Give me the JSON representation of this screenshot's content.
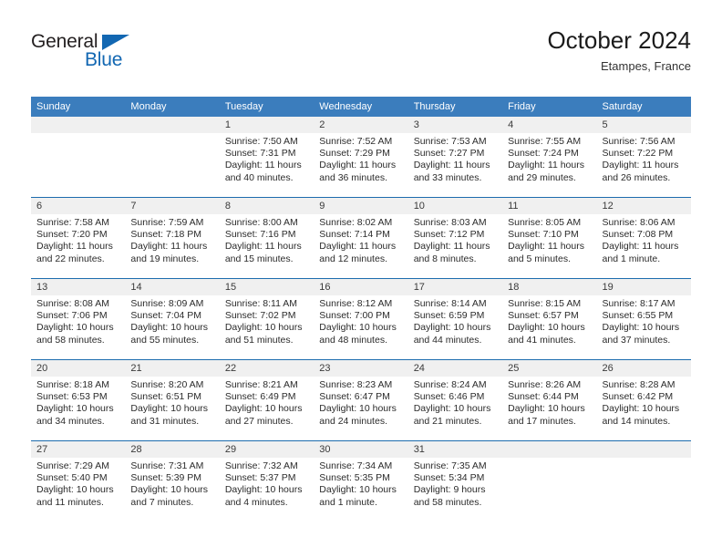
{
  "brand": {
    "name_top": "General",
    "name_bottom": "Blue",
    "triangle_color": "#1267b2"
  },
  "header": {
    "title": "October 2024",
    "subtitle": "Etampes, France"
  },
  "theme": {
    "header_blue": "#3b7dbd",
    "row_divider_blue": "#1d6cae",
    "daynum_band": "#f0f0f0"
  },
  "weekdays": [
    "Sunday",
    "Monday",
    "Tuesday",
    "Wednesday",
    "Thursday",
    "Friday",
    "Saturday"
  ],
  "labels": {
    "sunrise_prefix": "Sunrise:",
    "sunset_prefix": "Sunset:",
    "daylight_prefix": "Daylight:"
  },
  "weeks": [
    [
      {
        "day": "",
        "sunrise": "",
        "sunset": "",
        "daylight_a": "",
        "daylight_b": ""
      },
      {
        "day": "",
        "sunrise": "",
        "sunset": "",
        "daylight_a": "",
        "daylight_b": ""
      },
      {
        "day": "1",
        "sunrise": "Sunrise: 7:50 AM",
        "sunset": "Sunset: 7:31 PM",
        "daylight_a": "Daylight: 11 hours",
        "daylight_b": "and 40 minutes."
      },
      {
        "day": "2",
        "sunrise": "Sunrise: 7:52 AM",
        "sunset": "Sunset: 7:29 PM",
        "daylight_a": "Daylight: 11 hours",
        "daylight_b": "and 36 minutes."
      },
      {
        "day": "3",
        "sunrise": "Sunrise: 7:53 AM",
        "sunset": "Sunset: 7:27 PM",
        "daylight_a": "Daylight: 11 hours",
        "daylight_b": "and 33 minutes."
      },
      {
        "day": "4",
        "sunrise": "Sunrise: 7:55 AM",
        "sunset": "Sunset: 7:24 PM",
        "daylight_a": "Daylight: 11 hours",
        "daylight_b": "and 29 minutes."
      },
      {
        "day": "5",
        "sunrise": "Sunrise: 7:56 AM",
        "sunset": "Sunset: 7:22 PM",
        "daylight_a": "Daylight: 11 hours",
        "daylight_b": "and 26 minutes."
      }
    ],
    [
      {
        "day": "6",
        "sunrise": "Sunrise: 7:58 AM",
        "sunset": "Sunset: 7:20 PM",
        "daylight_a": "Daylight: 11 hours",
        "daylight_b": "and 22 minutes."
      },
      {
        "day": "7",
        "sunrise": "Sunrise: 7:59 AM",
        "sunset": "Sunset: 7:18 PM",
        "daylight_a": "Daylight: 11 hours",
        "daylight_b": "and 19 minutes."
      },
      {
        "day": "8",
        "sunrise": "Sunrise: 8:00 AM",
        "sunset": "Sunset: 7:16 PM",
        "daylight_a": "Daylight: 11 hours",
        "daylight_b": "and 15 minutes."
      },
      {
        "day": "9",
        "sunrise": "Sunrise: 8:02 AM",
        "sunset": "Sunset: 7:14 PM",
        "daylight_a": "Daylight: 11 hours",
        "daylight_b": "and 12 minutes."
      },
      {
        "day": "10",
        "sunrise": "Sunrise: 8:03 AM",
        "sunset": "Sunset: 7:12 PM",
        "daylight_a": "Daylight: 11 hours",
        "daylight_b": "and 8 minutes."
      },
      {
        "day": "11",
        "sunrise": "Sunrise: 8:05 AM",
        "sunset": "Sunset: 7:10 PM",
        "daylight_a": "Daylight: 11 hours",
        "daylight_b": "and 5 minutes."
      },
      {
        "day": "12",
        "sunrise": "Sunrise: 8:06 AM",
        "sunset": "Sunset: 7:08 PM",
        "daylight_a": "Daylight: 11 hours",
        "daylight_b": "and 1 minute."
      }
    ],
    [
      {
        "day": "13",
        "sunrise": "Sunrise: 8:08 AM",
        "sunset": "Sunset: 7:06 PM",
        "daylight_a": "Daylight: 10 hours",
        "daylight_b": "and 58 minutes."
      },
      {
        "day": "14",
        "sunrise": "Sunrise: 8:09 AM",
        "sunset": "Sunset: 7:04 PM",
        "daylight_a": "Daylight: 10 hours",
        "daylight_b": "and 55 minutes."
      },
      {
        "day": "15",
        "sunrise": "Sunrise: 8:11 AM",
        "sunset": "Sunset: 7:02 PM",
        "daylight_a": "Daylight: 10 hours",
        "daylight_b": "and 51 minutes."
      },
      {
        "day": "16",
        "sunrise": "Sunrise: 8:12 AM",
        "sunset": "Sunset: 7:00 PM",
        "daylight_a": "Daylight: 10 hours",
        "daylight_b": "and 48 minutes."
      },
      {
        "day": "17",
        "sunrise": "Sunrise: 8:14 AM",
        "sunset": "Sunset: 6:59 PM",
        "daylight_a": "Daylight: 10 hours",
        "daylight_b": "and 44 minutes."
      },
      {
        "day": "18",
        "sunrise": "Sunrise: 8:15 AM",
        "sunset": "Sunset: 6:57 PM",
        "daylight_a": "Daylight: 10 hours",
        "daylight_b": "and 41 minutes."
      },
      {
        "day": "19",
        "sunrise": "Sunrise: 8:17 AM",
        "sunset": "Sunset: 6:55 PM",
        "daylight_a": "Daylight: 10 hours",
        "daylight_b": "and 37 minutes."
      }
    ],
    [
      {
        "day": "20",
        "sunrise": "Sunrise: 8:18 AM",
        "sunset": "Sunset: 6:53 PM",
        "daylight_a": "Daylight: 10 hours",
        "daylight_b": "and 34 minutes."
      },
      {
        "day": "21",
        "sunrise": "Sunrise: 8:20 AM",
        "sunset": "Sunset: 6:51 PM",
        "daylight_a": "Daylight: 10 hours",
        "daylight_b": "and 31 minutes."
      },
      {
        "day": "22",
        "sunrise": "Sunrise: 8:21 AM",
        "sunset": "Sunset: 6:49 PM",
        "daylight_a": "Daylight: 10 hours",
        "daylight_b": "and 27 minutes."
      },
      {
        "day": "23",
        "sunrise": "Sunrise: 8:23 AM",
        "sunset": "Sunset: 6:47 PM",
        "daylight_a": "Daylight: 10 hours",
        "daylight_b": "and 24 minutes."
      },
      {
        "day": "24",
        "sunrise": "Sunrise: 8:24 AM",
        "sunset": "Sunset: 6:46 PM",
        "daylight_a": "Daylight: 10 hours",
        "daylight_b": "and 21 minutes."
      },
      {
        "day": "25",
        "sunrise": "Sunrise: 8:26 AM",
        "sunset": "Sunset: 6:44 PM",
        "daylight_a": "Daylight: 10 hours",
        "daylight_b": "and 17 minutes."
      },
      {
        "day": "26",
        "sunrise": "Sunrise: 8:28 AM",
        "sunset": "Sunset: 6:42 PM",
        "daylight_a": "Daylight: 10 hours",
        "daylight_b": "and 14 minutes."
      }
    ],
    [
      {
        "day": "27",
        "sunrise": "Sunrise: 7:29 AM",
        "sunset": "Sunset: 5:40 PM",
        "daylight_a": "Daylight: 10 hours",
        "daylight_b": "and 11 minutes."
      },
      {
        "day": "28",
        "sunrise": "Sunrise: 7:31 AM",
        "sunset": "Sunset: 5:39 PM",
        "daylight_a": "Daylight: 10 hours",
        "daylight_b": "and 7 minutes."
      },
      {
        "day": "29",
        "sunrise": "Sunrise: 7:32 AM",
        "sunset": "Sunset: 5:37 PM",
        "daylight_a": "Daylight: 10 hours",
        "daylight_b": "and 4 minutes."
      },
      {
        "day": "30",
        "sunrise": "Sunrise: 7:34 AM",
        "sunset": "Sunset: 5:35 PM",
        "daylight_a": "Daylight: 10 hours",
        "daylight_b": "and 1 minute."
      },
      {
        "day": "31",
        "sunrise": "Sunrise: 7:35 AM",
        "sunset": "Sunset: 5:34 PM",
        "daylight_a": "Daylight: 9 hours",
        "daylight_b": "and 58 minutes."
      },
      {
        "day": "",
        "sunrise": "",
        "sunset": "",
        "daylight_a": "",
        "daylight_b": ""
      },
      {
        "day": "",
        "sunrise": "",
        "sunset": "",
        "daylight_a": "",
        "daylight_b": ""
      }
    ]
  ]
}
